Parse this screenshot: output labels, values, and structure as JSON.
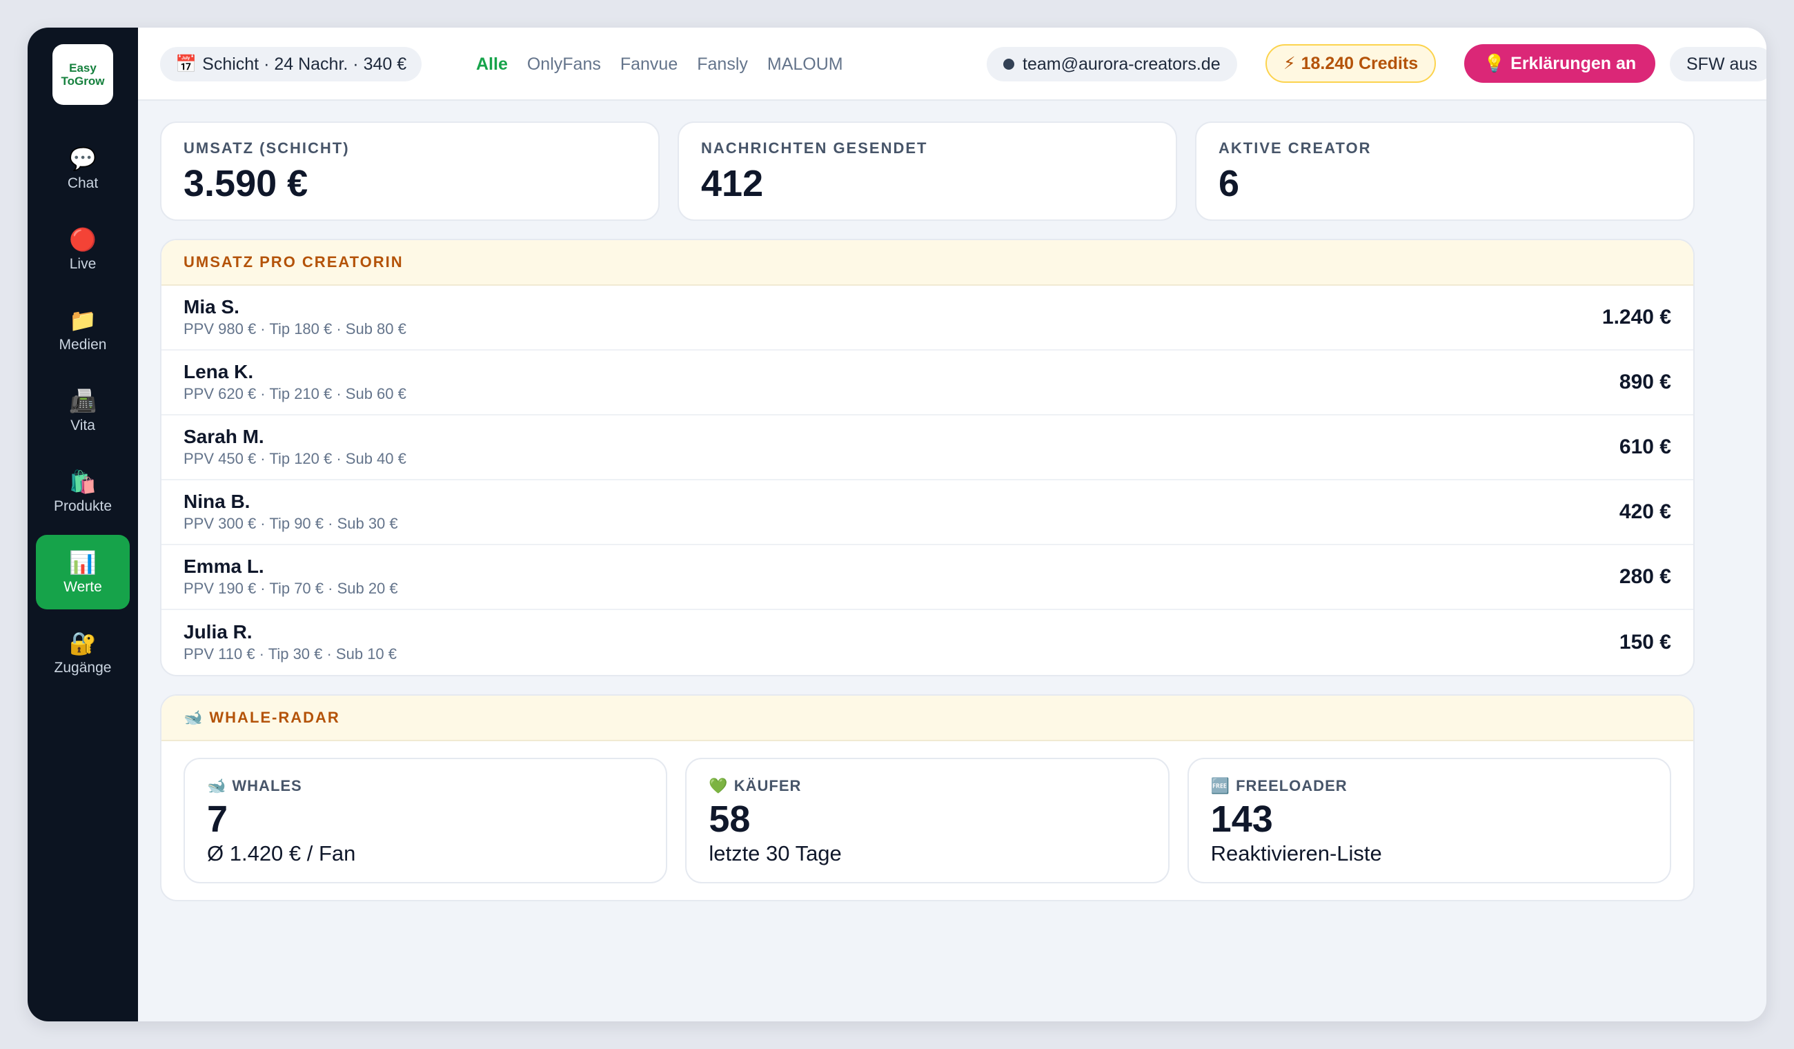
{
  "app": {
    "logo_line1": "Easy",
    "logo_line2": "ToGrow"
  },
  "sidebar": {
    "items": [
      {
        "icon": "💬",
        "icon_name": "chat-bubble-icon",
        "label": "Chat"
      },
      {
        "icon": "🔴",
        "icon_name": "live-red-dot-icon",
        "label": "Live"
      },
      {
        "icon": "📁",
        "icon_name": "folder-icon",
        "label": "Medien"
      },
      {
        "icon": "📠",
        "icon_name": "fax-machine-icon",
        "label": "Vita"
      },
      {
        "icon": "🛍️",
        "icon_name": "shopping-bags-icon",
        "label": "Produkte"
      },
      {
        "icon": "📊",
        "icon_name": "bar-chart-icon",
        "label": "Werte",
        "active": true
      },
      {
        "icon": "🔐",
        "icon_name": "lock-with-key-icon",
        "label": "Zugänge"
      }
    ]
  },
  "topbar": {
    "shift_icon": "📅",
    "shift_text": "Schicht · 24 Nachr. · 340 €",
    "tabs": [
      "Alle",
      "OnlyFans",
      "Fanvue",
      "Fansly",
      "MALOUM"
    ],
    "active_tab": "Alle",
    "email": "team@aurora-creators.de",
    "credits_icon": "⚡",
    "credits": "18.240 Credits",
    "explain_icon": "💡",
    "explain": "Erklärungen an",
    "sfw": "SFW aus"
  },
  "stats": [
    {
      "label": "UMSATZ (SCHICHT)",
      "value": "3.590 €"
    },
    {
      "label": "NACHRICHTEN GESENDET",
      "value": "412"
    },
    {
      "label": "AKTIVE CREATOR",
      "value": "6"
    }
  ],
  "revenue": {
    "title": "UMSATZ PRO CREATORIN",
    "rows": [
      {
        "name": "Mia S.",
        "detail": "PPV 980 € · Tip 180 € · Sub 80 €",
        "value": "1.240 €"
      },
      {
        "name": "Lena K.",
        "detail": "PPV 620 € · Tip 210 € · Sub 60 €",
        "value": "890 €"
      },
      {
        "name": "Sarah M.",
        "detail": "PPV 450 € · Tip 120 € · Sub 40 €",
        "value": "610 €"
      },
      {
        "name": "Nina B.",
        "detail": "PPV 300 € · Tip 90 € · Sub 30 €",
        "value": "420 €"
      },
      {
        "name": "Emma L.",
        "detail": "PPV 190 € · Tip 70 € · Sub 20 €",
        "value": "280 €"
      },
      {
        "name": "Julia R.",
        "detail": "PPV 110 € · Tip 30 € · Sub 10 €",
        "value": "150 €"
      }
    ]
  },
  "radar": {
    "icon": "🐋",
    "title": "WHALE-RADAR",
    "cards": [
      {
        "icon": "🐋",
        "icon_name": "whale-icon",
        "label": "WHALES",
        "value": "7",
        "sub": "Ø 1.420 € / Fan"
      },
      {
        "icon": "💚",
        "icon_name": "green-heart-icon",
        "label": "KÄUFER",
        "value": "58",
        "sub": "letzte 30 Tage"
      },
      {
        "icon": "🆓",
        "icon_name": "free-icon",
        "label": "FREELOADER",
        "value": "143",
        "sub": "Reaktivieren-Liste"
      }
    ]
  }
}
